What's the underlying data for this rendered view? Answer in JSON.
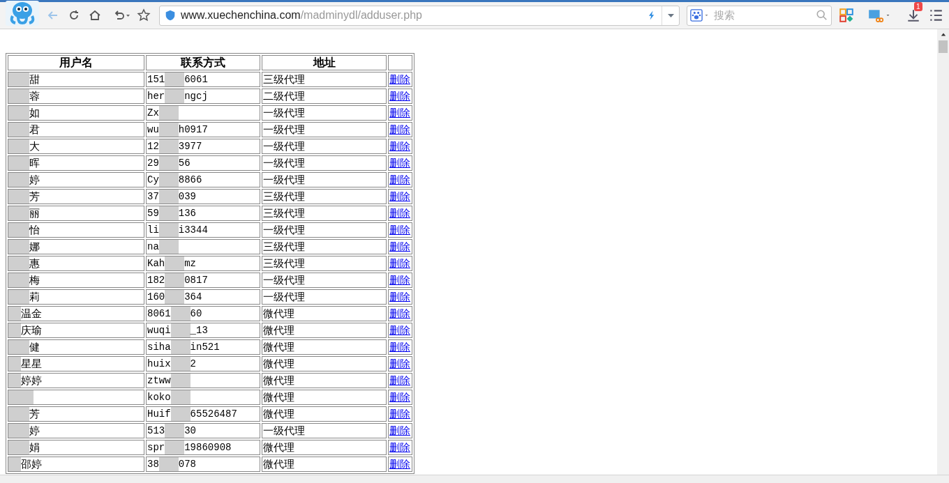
{
  "toolbar": {
    "url_host": "www.xuechenchina.com",
    "url_path": "/madminydl/adduser.php",
    "search_placeholder": "搜索",
    "download_badge": "1"
  },
  "table": {
    "columns": [
      "用户名",
      "联系方式",
      "地址"
    ],
    "rows": [
      {
        "name": "甜",
        "contact_start": "151",
        "contact_end": "6061",
        "address": "三级代理",
        "action": "删除"
      },
      {
        "name": "蓉",
        "contact_start": "her",
        "contact_end": "ngcj",
        "address": "二级代理",
        "action": "删除"
      },
      {
        "name": "如",
        "contact_start": "Zx",
        "address": "一级代理",
        "action": "删除"
      },
      {
        "name": "君",
        "contact_start": "wu",
        "contact_end": "h0917",
        "address": "一级代理",
        "action": "删除"
      },
      {
        "name": "大",
        "contact_start": "12",
        "contact_end": "3977",
        "address": "一级代理",
        "action": "删除"
      },
      {
        "name": "晖",
        "contact_start": "29",
        "contact_end": "56",
        "address": "一级代理",
        "action": "删除"
      },
      {
        "name": "婷",
        "contact_start": "Cy",
        "contact_end": "8866",
        "address": "一级代理",
        "action": "删除"
      },
      {
        "name": "芳",
        "contact_start": "37",
        "contact_end": "039",
        "address": "三级代理",
        "action": "删除"
      },
      {
        "name": "丽",
        "contact_start": "59",
        "contact_end": "136",
        "address": "三级代理",
        "action": "删除"
      },
      {
        "name": "怡",
        "contact_start": "li",
        "contact_end": "i3344",
        "address": "一级代理",
        "action": "删除"
      },
      {
        "name": "娜",
        "contact_start": "na",
        "address": "三级代理",
        "action": "删除"
      },
      {
        "name": "惠",
        "contact_start": "Kah",
        "contact_end": "mz",
        "address": "三级代理",
        "action": "删除"
      },
      {
        "name": "梅",
        "contact_start": "182",
        "contact_end": "0817",
        "address": "一级代理",
        "action": "删除"
      },
      {
        "name": "莉",
        "contact_start": "160",
        "contact_end": "364",
        "address": "一级代理",
        "action": "删除"
      },
      {
        "name": "温金",
        "contact_start": "8061",
        "contact_end": "60",
        "address": "微代理",
        "action": "删除"
      },
      {
        "name": "庆瑜",
        "contact_start": "wuqi",
        "contact_end": "_13",
        "address": "微代理",
        "action": "删除"
      },
      {
        "name": "健",
        "contact_start": "siha",
        "contact_end": "in521",
        "address": "微代理",
        "action": "删除"
      },
      {
        "name": "星星",
        "contact_start": "huix",
        "contact_end": "2",
        "address": "微代理",
        "action": "删除"
      },
      {
        "name": "婷婷",
        "contact_start": "ztww",
        "address": "微代理",
        "action": "删除"
      },
      {
        "contact_start": "koko",
        "address": "微代理",
        "action": "删除"
      },
      {
        "name": "芳",
        "contact_start": "Huif",
        "contact_end": "65526487",
        "address": "微代理",
        "action": "删除"
      },
      {
        "name": "婷",
        "contact_start": "513",
        "contact_end": "30",
        "address": "一级代理",
        "action": "删除"
      },
      {
        "name": "娟",
        "contact_start": "spr",
        "contact_end": "19860908",
        "address": "微代理",
        "action": "删除"
      },
      {
        "name": "邵婷",
        "contact_start": "38",
        "contact_end": "078",
        "address": "微代理",
        "action": "删除"
      }
    ]
  }
}
